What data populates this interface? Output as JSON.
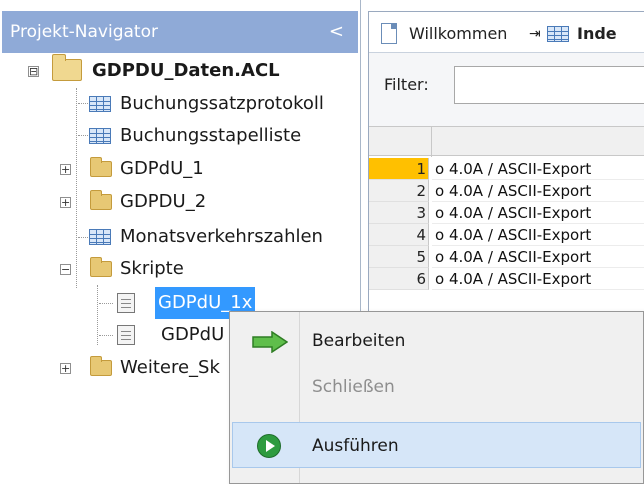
{
  "navigator": {
    "title": "Projekt-Navigator",
    "collapse_glyph": "<",
    "items": [
      {
        "label": "GDPDU_Daten.ACL",
        "icon": "project-folder-icon",
        "expander": "⊟"
      },
      {
        "label": "Buchungssatzprotokoll",
        "icon": "table-icon"
      },
      {
        "label": "Buchungsstapelliste",
        "icon": "table-icon"
      },
      {
        "label": "GDPdU_1",
        "icon": "folder-icon",
        "expander": "+"
      },
      {
        "label": "GDPDU_2",
        "icon": "folder-icon",
        "expander": "+"
      },
      {
        "label": "Monatsverkehrszahlen",
        "icon": "table-icon"
      },
      {
        "label": "Skripte",
        "icon": "folder-icon",
        "expander": "−"
      },
      {
        "label": "GDPdU_1x",
        "icon": "script-icon"
      },
      {
        "label": "GDPdU",
        "icon": "script-icon"
      },
      {
        "label": "Weitere_Sk",
        "icon": "folder-icon",
        "expander": "+"
      }
    ]
  },
  "tabs": [
    {
      "label": "Willkommen",
      "pin": "⇥"
    },
    {
      "label": "Inde"
    }
  ],
  "filter": {
    "label": "Filter:",
    "value": ""
  },
  "grid": {
    "rows": [
      {
        "num": "1",
        "text": "o 4.0A / ASCII-Export"
      },
      {
        "num": "2",
        "text": "o 4.0A / ASCII-Export"
      },
      {
        "num": "3",
        "text": "o 4.0A / ASCII-Export"
      },
      {
        "num": "4",
        "text": "o 4.0A / ASCII-Export"
      },
      {
        "num": "5",
        "text": "o 4.0A / ASCII-Export"
      },
      {
        "num": "6",
        "text": "o 4.0A / ASCII-Export"
      }
    ]
  },
  "context_menu": {
    "items": [
      {
        "label": "Bearbeiten",
        "icon": "green-arrow-icon"
      },
      {
        "label": "Schließen",
        "disabled": true
      },
      {
        "label": "Ausführen",
        "icon": "play-icon"
      }
    ]
  },
  "colors": {
    "header_bg": "#8faad7",
    "selection": "#3399ff",
    "active_row": "#ffc000",
    "menu_hover": "#d6e6f8"
  }
}
